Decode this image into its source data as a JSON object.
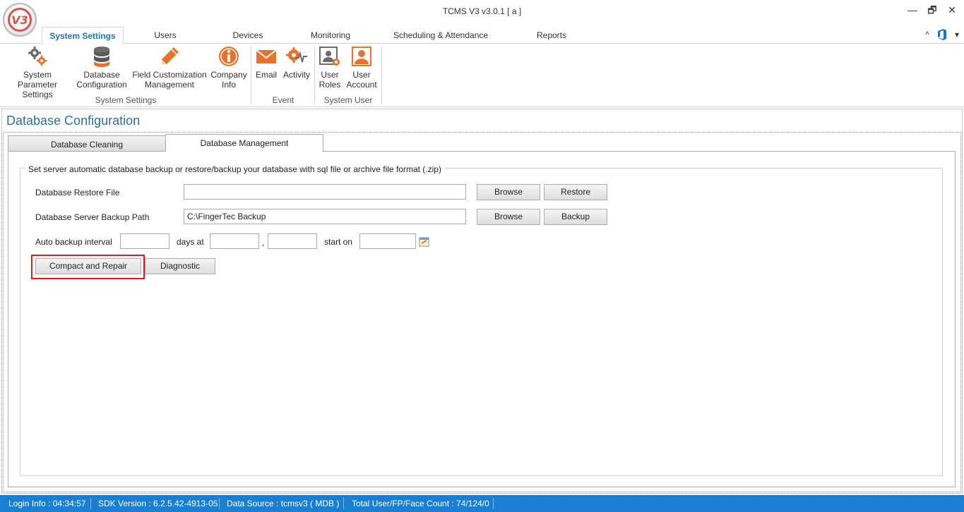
{
  "window": {
    "title": "TCMS V3 v3.0.1 [ a ]",
    "logo_text": "V3",
    "minimize": "—",
    "restore": "🗗",
    "close": "✕"
  },
  "ribbon": {
    "tabs": [
      {
        "label": "System Settings"
      },
      {
        "label": "Users"
      },
      {
        "label": "Devices"
      },
      {
        "label": "Monitoring"
      },
      {
        "label": "Scheduling & Attendance"
      },
      {
        "label": "Reports"
      }
    ],
    "right": {
      "collapse": "^",
      "office": "office-icon",
      "more": "▾"
    },
    "buttons": {
      "system_parameter": {
        "line1": "System Parameter",
        "line2": "Settings",
        "icon": "gears-icon"
      },
      "database_config": {
        "line1": "Database",
        "line2": "Configuration",
        "icon": "database-icon"
      },
      "field_custom": {
        "line1": "Field Customization",
        "line2": "Management",
        "icon": "pencil-icon"
      },
      "company_info": {
        "line1": "Company",
        "line2": "Info",
        "icon": "info-icon"
      },
      "email": {
        "line1": "Email",
        "icon": "envelope-icon"
      },
      "activity": {
        "line1": "Activity",
        "icon": "activity-icon"
      },
      "user_roles": {
        "line1": "User",
        "line2": "Roles",
        "icon": "user-roles-icon"
      },
      "user_account": {
        "line1": "User",
        "line2": "Account",
        "icon": "user-account-icon"
      }
    },
    "groups": {
      "system_settings": "System Settings",
      "event": "Event",
      "system_user": "System User"
    }
  },
  "document": {
    "title": "Database Configuration",
    "tabs": [
      {
        "label": "Database Cleaning"
      },
      {
        "label": "Database Management"
      }
    ],
    "groupbox_legend": "Set server automatic database backup or restore/backup your database with sql file or archive file format (.zip)",
    "restore": {
      "label": "Database Restore File",
      "value": "",
      "browse": "Browse",
      "action": "Restore"
    },
    "backup": {
      "label": "Database Server Backup Path",
      "value": "C:\\FingerTec Backup",
      "browse": "Browse",
      "action": "Backup"
    },
    "interval": {
      "label": "Auto backup interval",
      "days_value": "",
      "days_at": "days at",
      "hour_value": "",
      "comma": ",",
      "minute_value": "",
      "start_on": "start on",
      "start_value": ""
    },
    "compact_repair": "Compact and Repair",
    "diagnostic": "Diagnostic"
  },
  "status": {
    "login": "Login Info : 04:34:57",
    "sdk": "SDK Version : 6.2.5.42-4913-05",
    "datasource": "Data Source : tcmsv3 ( MDB )",
    "counts": "Total User/FP/Face Count : 74/124/0"
  }
}
